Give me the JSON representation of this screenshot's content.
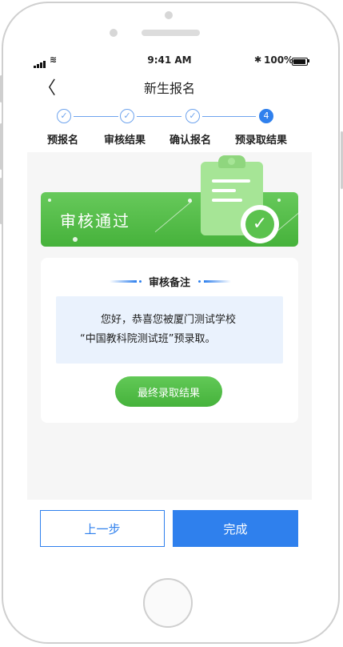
{
  "statusbar": {
    "time": "9:41 AM",
    "battery_pct": "100%",
    "wifi_icon": "≋",
    "bluetooth_icon": "✱"
  },
  "navbar": {
    "back_icon": "〈",
    "title": "新生报名"
  },
  "steps": [
    {
      "label": "预报名",
      "marker": "✓",
      "state": "done"
    },
    {
      "label": "审核结果",
      "marker": "✓",
      "state": "done"
    },
    {
      "label": "确认报名",
      "marker": "✓",
      "state": "done"
    },
    {
      "label": "预录取结果",
      "marker": "4",
      "state": "active"
    }
  ],
  "banner": {
    "text": "审核通过",
    "check_icon": "✓"
  },
  "card": {
    "heading": "审核备注",
    "note_line1": "您好，恭喜您被厦门测试学校",
    "note_line2": "“中国教科院测试班”预录取。",
    "final_button": "最终录取结果"
  },
  "footer": {
    "prev_label": "上一步",
    "done_label": "完成"
  },
  "colors": {
    "primary": "#2f80ed",
    "success": "#4bb540",
    "note_bg": "#eaf2fd"
  }
}
